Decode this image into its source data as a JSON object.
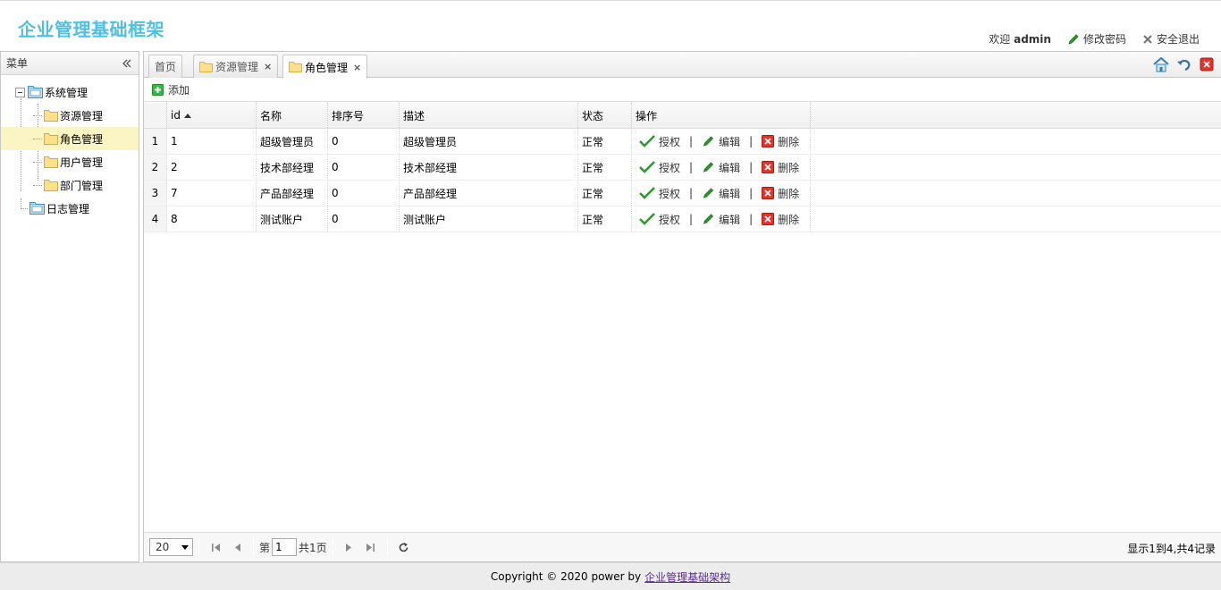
{
  "header": {
    "title": "企业管理基础框架",
    "welcome_prefix": "欢迎",
    "username": "admin",
    "change_password": "修改密码",
    "logout": "安全退出"
  },
  "menu": {
    "title": "菜单",
    "root": {
      "label": "系统管理",
      "icon": "folder-open-icon"
    },
    "children": [
      {
        "label": "资源管理",
        "selected": false
      },
      {
        "label": "角色管理",
        "selected": true
      },
      {
        "label": "用户管理",
        "selected": false
      },
      {
        "label": "部门管理",
        "selected": false
      }
    ],
    "root2": {
      "label": "日志管理",
      "icon": "folder-open-icon"
    }
  },
  "tabs": [
    {
      "label": "首页",
      "closable": false,
      "active": false
    },
    {
      "label": "资源管理",
      "closable": true,
      "active": false
    },
    {
      "label": "角色管理",
      "closable": true,
      "active": true
    }
  ],
  "toolbar": {
    "add_label": "添加"
  },
  "grid": {
    "columns": {
      "id": "id",
      "name": "名称",
      "sort": "排序号",
      "desc": "描述",
      "status": "状态",
      "op": "操作"
    },
    "rows": [
      {
        "rn": "1",
        "id": "1",
        "name": "超级管理员",
        "sort": "0",
        "desc": "超级管理员",
        "status": "正常"
      },
      {
        "rn": "2",
        "id": "2",
        "name": "技术部经理",
        "sort": "0",
        "desc": "技术部经理",
        "status": "正常"
      },
      {
        "rn": "3",
        "id": "7",
        "name": "产品部经理",
        "sort": "0",
        "desc": "产品部经理",
        "status": "正常"
      },
      {
        "rn": "4",
        "id": "8",
        "name": "测试账户",
        "sort": "0",
        "desc": "测试账户",
        "status": "正常"
      }
    ],
    "actions": {
      "grant": "授权",
      "edit": "编辑",
      "delete": "删除",
      "separator": "|"
    }
  },
  "pager": {
    "page_size": "20",
    "page_prefix": "第",
    "page_value": "1",
    "page_suffix": "共1页",
    "info": "显示1到4,共4记录"
  },
  "footer": {
    "text": "Copyright © 2020 power by",
    "link": "企业管理基础架构"
  },
  "colors": {
    "brand": "#4fbfe3",
    "selected_row": "#fbf5c4",
    "grant_green": "#2e9a2e",
    "delete_red": "#d9261c"
  }
}
